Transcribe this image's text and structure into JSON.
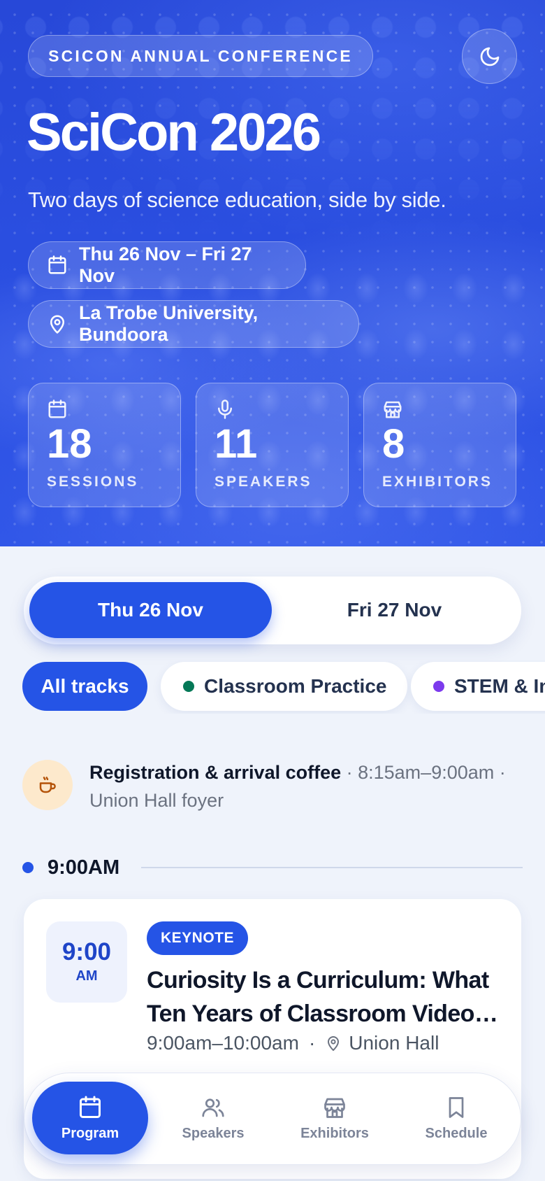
{
  "hero": {
    "eyebrow": "SCICON ANNUAL CONFERENCE",
    "title": "SciCon 2026",
    "subtitle": "Two days of science education, side by side.",
    "dates": "Thu 26 Nov – Fri 27 Nov",
    "location": "La Trobe University, Bundoora",
    "theme_toggle_icon": "moon-icon",
    "stats": [
      {
        "icon": "calendar-icon",
        "value": "18",
        "label": "SESSIONS"
      },
      {
        "icon": "microphone-icon",
        "value": "11",
        "label": "SPEAKERS"
      },
      {
        "icon": "store-icon",
        "value": "8",
        "label": "EXHIBITORS"
      }
    ]
  },
  "day_tabs": [
    {
      "label": "Thu 26 Nov",
      "active": true
    },
    {
      "label": "Fri 27 Nov",
      "active": false
    }
  ],
  "tracks": [
    {
      "label": "All tracks",
      "active": true
    },
    {
      "label": "Classroom Practice",
      "dot_color": "#047857"
    },
    {
      "label": "STEM & Inn",
      "dot_color": "#7c3aed"
    }
  ],
  "schedule": {
    "break": {
      "icon": "coffee-icon",
      "title": "Registration & arrival coffee",
      "time": " · 8:15am–9:00am · ",
      "location": "Union Hall foyer"
    },
    "time_marker": "9:00AM",
    "session": {
      "time": "9:00",
      "ampm": "AM",
      "kind": "KEYNOTE",
      "title": "Curiosity Is a Curriculum: What Ten Years of Classroom Video…",
      "range": "9:00am–10:00am",
      "separator": "·",
      "room": "Union Hall"
    }
  },
  "nav": [
    {
      "label": "Program",
      "icon": "calendar-icon",
      "active": true
    },
    {
      "label": "Speakers",
      "icon": "users-icon"
    },
    {
      "label": "Exhibitors",
      "icon": "store-icon"
    },
    {
      "label": "Schedule",
      "icon": "bookmark-icon"
    }
  ],
  "colors": {
    "accent": "#2554e6",
    "hero_bg": "#2a4ee0",
    "page_bg": "#eff3fb",
    "classroom_practice": "#047857",
    "stem": "#7c3aed",
    "coffee_bg": "#fde9cc"
  }
}
